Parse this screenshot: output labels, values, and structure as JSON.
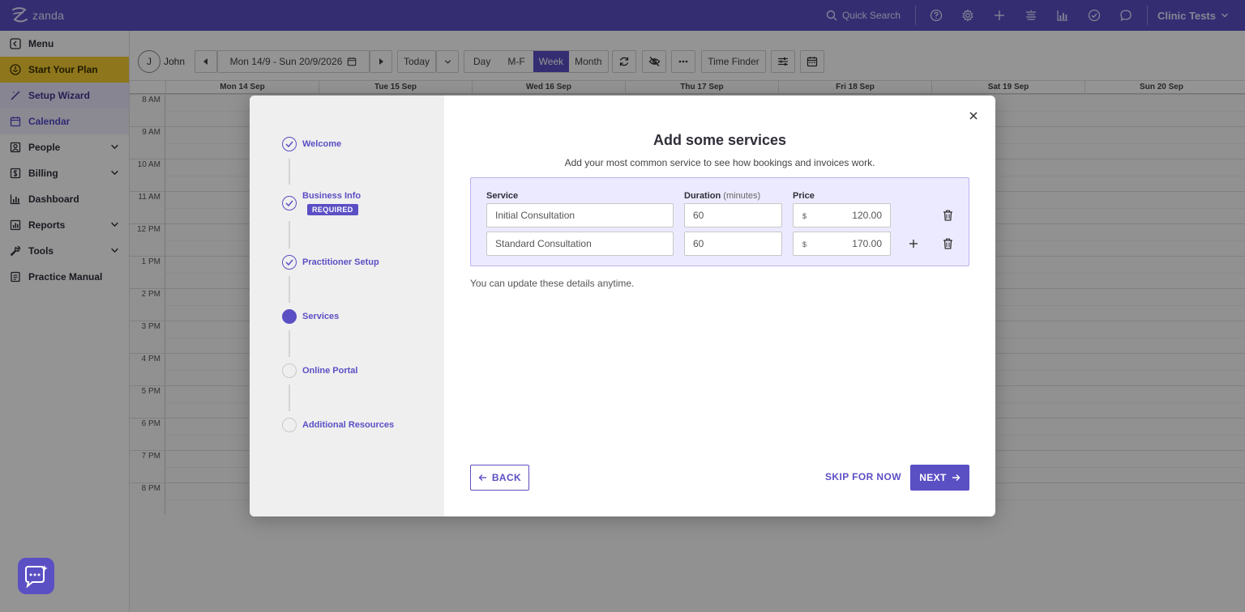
{
  "app": {
    "logo_text": "zanda"
  },
  "topbar": {
    "search_label": "Quick Search",
    "icons": [
      "help-icon",
      "gear-icon",
      "plus-icon",
      "filter-lines-icon",
      "chart-icon",
      "check-circle-icon",
      "chat-icon"
    ],
    "clinic_name": "Clinic Tests"
  },
  "sidebar": {
    "items": [
      {
        "label": "Menu",
        "icon": "menu-icon"
      },
      {
        "label": "Start Your Plan",
        "icon": "plan-icon"
      },
      {
        "label": "Setup Wizard",
        "icon": "wand-icon"
      },
      {
        "label": "Calendar",
        "icon": "calendar-icon"
      },
      {
        "label": "People",
        "icon": "people-icon"
      },
      {
        "label": "Billing",
        "icon": "billing-icon"
      },
      {
        "label": "Dashboard",
        "icon": "dashboard-icon"
      },
      {
        "label": "Reports",
        "icon": "reports-icon"
      },
      {
        "label": "Tools",
        "icon": "tools-icon"
      },
      {
        "label": "Practice Manual",
        "icon": "manual-icon"
      }
    ]
  },
  "calendar": {
    "user_initial": "J",
    "user_name": "John",
    "date_range": "Mon 14/9 - Sun 20/9/2026",
    "today_label": "Today",
    "views": [
      "Day",
      "M-F",
      "Week",
      "Month"
    ],
    "active_view": "Week",
    "time_finder_label": "Time Finder",
    "days": [
      "Mon 14 Sep",
      "Tue 15 Sep",
      "Wed 16 Sep",
      "Thu 17 Sep",
      "Fri 18 Sep",
      "Sat 19 Sep",
      "Sun 20 Sep"
    ],
    "hours": [
      "8 AM",
      "9 AM",
      "10 AM",
      "11 AM",
      "12 PM",
      "1 PM",
      "2 PM",
      "3 PM",
      "4 PM",
      "5 PM",
      "6 PM",
      "7 PM",
      "8 PM"
    ]
  },
  "wizard": {
    "steps": [
      {
        "label": "Welcome",
        "status": "done"
      },
      {
        "label": "Business Info",
        "status": "done",
        "badge": "REQUIRED"
      },
      {
        "label": "Practitioner Setup",
        "status": "done"
      },
      {
        "label": "Services",
        "status": "current"
      },
      {
        "label": "Online Portal",
        "status": "todo"
      },
      {
        "label": "Additional Resources",
        "status": "todo"
      }
    ],
    "title": "Add some services",
    "subtitle": "Add your most common service to see how bookings and invoices work.",
    "columns": {
      "service": "Service",
      "duration": "Duration",
      "duration_unit": "(minutes)",
      "price": "Price"
    },
    "currency_symbol": "$",
    "services": [
      {
        "name": "Initial Consultation",
        "duration": "60",
        "price": "120.00"
      },
      {
        "name": "Standard Consultation",
        "duration": "60",
        "price": "170.00"
      }
    ],
    "note": "You can update these details anytime.",
    "back_label": "BACK",
    "skip_label": "SKIP FOR NOW",
    "next_label": "NEXT"
  },
  "colors": {
    "brand": "#5b4fc4",
    "plan_highlight": "#f4cc33"
  }
}
